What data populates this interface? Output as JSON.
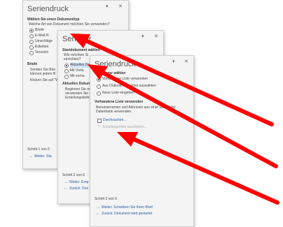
{
  "panel1": {
    "title": "Seriendruck",
    "heading": "Wählen Sie einen Dokumenttyp",
    "question": "Welche Art von Dokument möchten Sie verwenden?",
    "options": [
      "Briefe",
      "E-Mail-N",
      "Umschläge",
      "Etiketten",
      "Verzeich"
    ],
    "section": "Briefe",
    "desc1": "Senden Sie Brie",
    "desc2": "können jedem B",
    "desc3": "Klicken Sie auf \"W",
    "step": "Schritt 1 von 6",
    "next": "Weiter: Sta"
  },
  "panel2": {
    "title": "Seriendr",
    "heading": "Startdokument wählen",
    "q1": "Wie möchten Si",
    "q2": "einrichten?",
    "options": [
      "Aktuelles Do",
      "Mit Vorla",
      "Mit vorha"
    ],
    "section": "Aktuelles Dokume",
    "desc1": "Beginnen Sie mit",
    "desc2": "verwenden Sie d",
    "desc3": "Erstellungsbefehl",
    "step": "Schritt 2 von 6",
    "next": "Weiter: Emp",
    "prev": "Zurück: Dok"
  },
  "panel3": {
    "title": "Seriendruck",
    "heading": "Empfänger wählen",
    "options": [
      "Vorhandene Liste verwenden",
      "Aus Outlook-Kontakten auswählen",
      "Neue Liste eingeben"
    ],
    "section": "Vorhandene Liste verwenden",
    "desc1": "Benutzernamen und Adressen aus einer Datei oder",
    "desc2": "Datenbank verwenden.",
    "browse": "Durchsuchen...",
    "edit": "Empfängerliste bearbeiten...",
    "step": "Schritt 3 von 6",
    "next": "Weiter: Schreiben Sie Ihren Brief",
    "prev": "Zurück: Dokument wird gestartet"
  }
}
